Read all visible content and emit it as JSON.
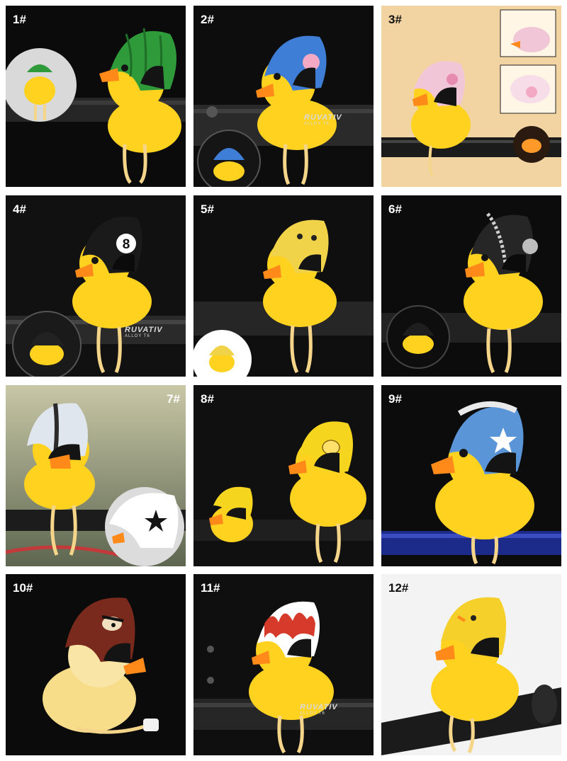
{
  "cells": [
    {
      "label": "1#",
      "helmet": "green watermelon helmet",
      "colors": {
        "bg": "#0b0b0b",
        "helmet": "#2f9a3a"
      }
    },
    {
      "label": "2#",
      "helmet": "blue pig helmet",
      "colors": {
        "bg": "#0d0d0d",
        "helmet": "#3f7ed6"
      },
      "brand": "RUVATIV",
      "brand_sub": "ALLOY T6"
    },
    {
      "label": "3#",
      "helmet": "pink pig helmet",
      "colors": {
        "bg": "#f2d4a2",
        "helmet": "#f1c7d8"
      }
    },
    {
      "label": "4#",
      "helmet": "black 8-ball helmet",
      "colors": {
        "bg": "#111111",
        "helmet": "#1a1a1a"
      },
      "ball_number": "8",
      "brand": "RUVATIV",
      "brand_sub": "ALLOY T6"
    },
    {
      "label": "5#",
      "helmet": "yellow chick helmet",
      "colors": {
        "bg": "#0f0f0f",
        "helmet": "#f1d34a"
      }
    },
    {
      "label": "6#",
      "helmet": "black racing helmet",
      "colors": {
        "bg": "#0c0c0c",
        "helmet": "#262626"
      }
    },
    {
      "label": "7#",
      "helmet": "white star helmet",
      "colors": {
        "bg": "#a6a58a",
        "helmet": "#dfe6ee"
      }
    },
    {
      "label": "8#",
      "helmet": "yellow duck helmet",
      "colors": {
        "bg": "#101010",
        "helmet": "#f5d51e"
      }
    },
    {
      "label": "9#",
      "helmet": "blue star helmet",
      "colors": {
        "bg": "#0c0c0c",
        "helmet": "#5a95d8"
      }
    },
    {
      "label": "10#",
      "helmet": "brown angry bird helmet",
      "colors": {
        "bg": "#0b0b0b",
        "helmet": "#7a2a1c"
      }
    },
    {
      "label": "11#",
      "helmet": "red flame helmet",
      "colors": {
        "bg": "#0f0f0f",
        "helmet": "#d63a2a"
      },
      "brand": "RUVATIV",
      "brand_sub": "ALLOY T6"
    },
    {
      "label": "12#",
      "helmet": "yellow duck helmet",
      "colors": {
        "bg": "#f3f3f3",
        "helmet": "#f5cf2a"
      }
    }
  ],
  "palette": {
    "duck": "#ffd21f",
    "duck_shade": "#f0b400",
    "beak": "#ff8a1a",
    "visor": "#141414"
  }
}
